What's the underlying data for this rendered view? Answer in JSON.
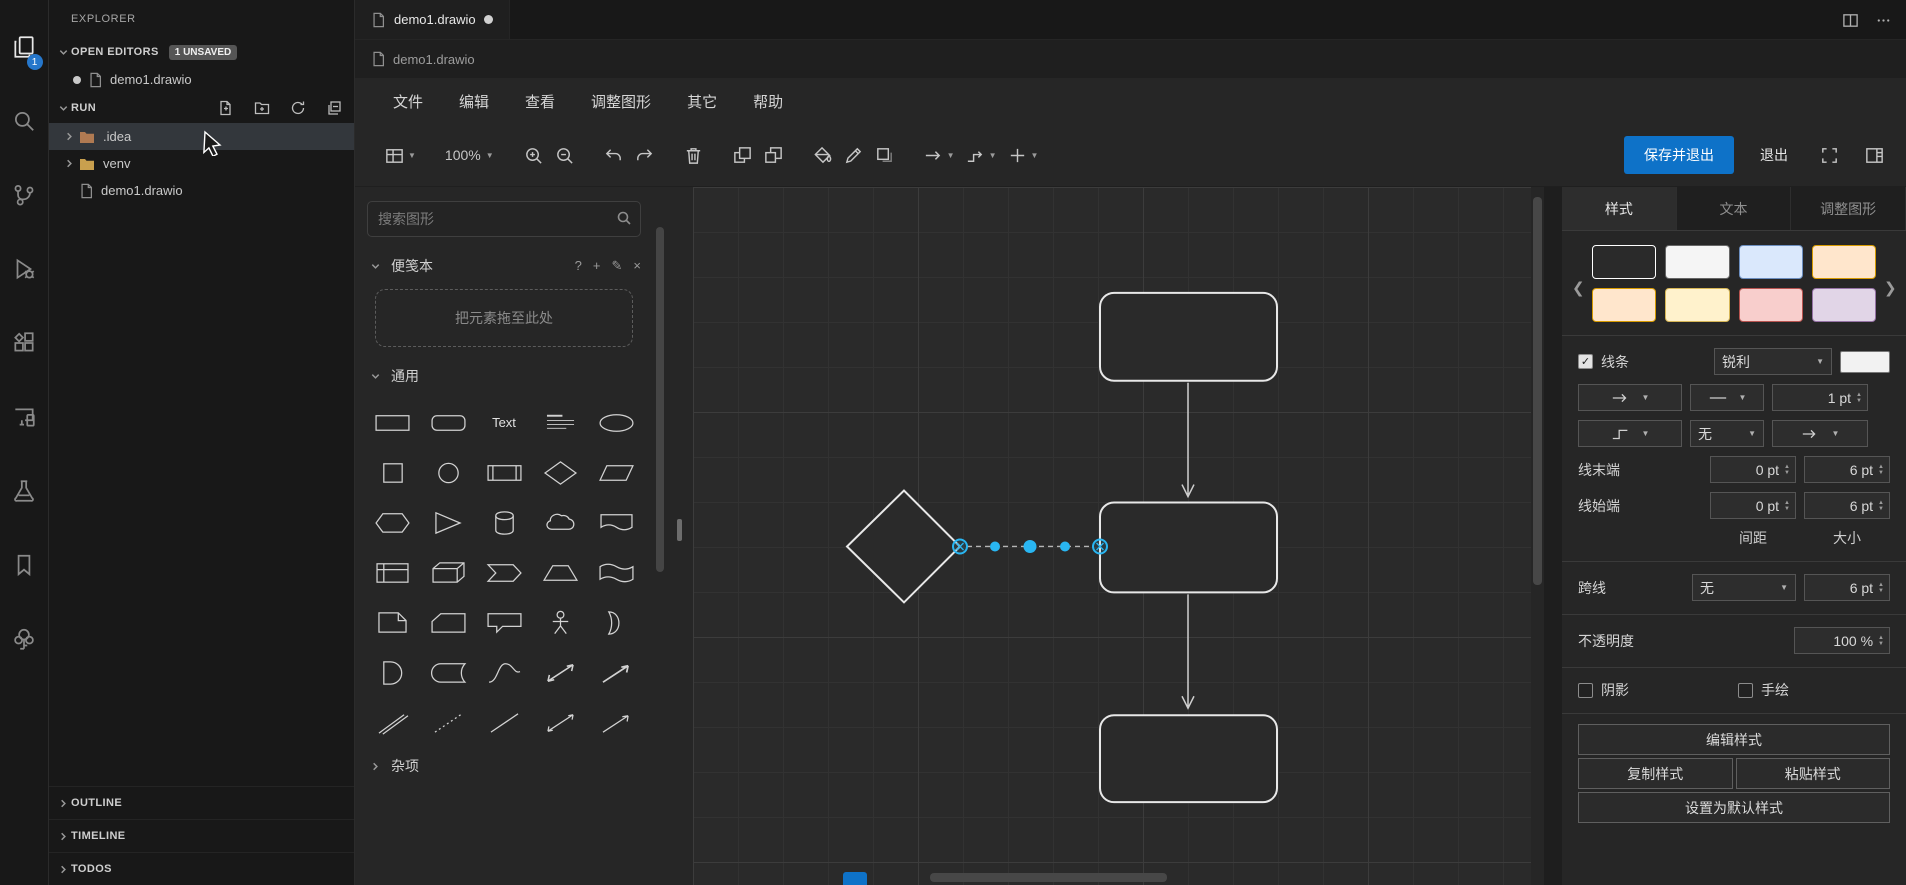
{
  "activity_bar": {
    "unsaved_badge": "1",
    "icons": [
      "files",
      "search",
      "source-control",
      "run-and-debug",
      "extensions",
      "remote-explorer",
      "testing",
      "bookmarks",
      "todo-tree"
    ]
  },
  "sidebar": {
    "title": "EXPLORER",
    "open_editors": {
      "label": "OPEN EDITORS",
      "badge": "1 UNSAVED",
      "items": [
        {
          "name": "demo1.drawio",
          "modified": true
        }
      ]
    },
    "project": {
      "label": "RUN",
      "toolbar_icons": [
        "new-file",
        "new-folder",
        "refresh",
        "collapse-all"
      ],
      "items": [
        {
          "name": ".idea",
          "type": "folder",
          "selected": true
        },
        {
          "name": "venv",
          "type": "folder",
          "selected": false
        },
        {
          "name": "demo1.drawio",
          "type": "file",
          "selected": false
        }
      ]
    },
    "bottom_sections": [
      {
        "label": "OUTLINE"
      },
      {
        "label": "TIMELINE"
      },
      {
        "label": "TODOS"
      }
    ]
  },
  "editor": {
    "tab": {
      "label": "demo1.drawio",
      "modified": true
    },
    "breadcrumb": "demo1.drawio"
  },
  "drawio": {
    "menu": [
      "文件",
      "编辑",
      "查看",
      "调整图形",
      "其它",
      "帮助"
    ],
    "toolbar": {
      "zoom": "100%",
      "icons": [
        "view",
        "zoom-in",
        "zoom-out",
        "undo",
        "redo",
        "delete",
        "to-front",
        "to-back",
        "fill-color",
        "line-color",
        "shadow",
        "connection",
        "waypoints",
        "insert",
        "fullscreen",
        "format-panel"
      ],
      "save_exit_label": "保存并退出",
      "exit_label": "退出"
    },
    "shapes_panel": {
      "search_placeholder": "搜索图形",
      "scratchpad": {
        "label": "便笺本",
        "drop_hint": "把元素拖至此处"
      },
      "general_label": "通用",
      "text_shape_label": "Text",
      "misc_label": "杂项",
      "shapes": [
        "rectangle",
        "rounded-rectangle",
        "text",
        "textbox",
        "ellipse",
        "square",
        "circle",
        "process",
        "diamond",
        "parallelogram",
        "hexagon",
        "triangle",
        "cylinder",
        "cloud",
        "document",
        "internal-storage",
        "cube",
        "step",
        "trapezoid",
        "tape",
        "note",
        "card",
        "callout",
        "actor",
        "or",
        "and",
        "data-storage",
        "curve",
        "bidirectional-arrow",
        "arrow",
        "link",
        "dotted-line",
        "line",
        "bidirectional-connector",
        "directional-connector"
      ]
    },
    "canvas": {
      "diagram": {
        "nodes": [
          {
            "id": "top",
            "shape": "rounded-rectangle",
            "label": ""
          },
          {
            "id": "middle",
            "shape": "rounded-rectangle",
            "label": ""
          },
          {
            "id": "decision",
            "shape": "diamond",
            "label": ""
          },
          {
            "id": "bottom",
            "shape": "rounded-rectangle",
            "label": ""
          }
        ],
        "edges": [
          {
            "from": "top",
            "to": "middle",
            "selected": false
          },
          {
            "from": "middle",
            "to": "bottom",
            "selected": false
          },
          {
            "from": "decision",
            "to": "middle",
            "selected": true
          }
        ]
      }
    },
    "format_panel": {
      "tabs": [
        "样式",
        "文本",
        "调整图形"
      ],
      "active_tab": "样式",
      "style_presets": [
        {
          "fill": "#2a2a2a",
          "stroke": "#ffffff"
        },
        {
          "fill": "#f5f5f5",
          "stroke": "#666666"
        },
        {
          "fill": "#dae8fc",
          "stroke": "#6c8ebf"
        },
        {
          "fill": "#ffe6cc",
          "stroke": "#d79b00"
        },
        {
          "fill": "#ffe6cc",
          "stroke": "#d79b00"
        },
        {
          "fill": "#fff2cc",
          "stroke": "#d6b656"
        },
        {
          "fill": "#f8cecc",
          "stroke": "#b85450"
        },
        {
          "fill": "#e1d5e7",
          "stroke": "#9673a6"
        }
      ],
      "line": {
        "label": "线条",
        "checked": true,
        "style": "锐利",
        "width": "1 pt"
      },
      "waypoints_value": "无",
      "line_end": {
        "label": "线末端",
        "spacing": "0 pt",
        "size": "6 pt"
      },
      "line_start": {
        "label": "线始端",
        "spacing": "0 pt",
        "size": "6 pt"
      },
      "spacing_label": "间距",
      "size_label": "大小",
      "jumps": {
        "label": "跨线",
        "style": "无",
        "size": "6 pt"
      },
      "opacity": {
        "label": "不透明度",
        "value": "100 %"
      },
      "shadow": {
        "label": "阴影",
        "checked": false
      },
      "sketch": {
        "label": "手绘",
        "checked": false
      },
      "buttons": {
        "edit_style": "编辑样式",
        "copy_style": "复制样式",
        "paste_style": "粘贴样式",
        "set_default": "设置为默认样式"
      }
    }
  },
  "colors": {
    "accent_blue": "#0e72c8",
    "selection_handle": "#29b6f2",
    "badge_blue": "#2677cb",
    "canvas_bg": "#2a2a2a",
    "panel_bg": "#262626",
    "vscode_bg": "#181818"
  }
}
